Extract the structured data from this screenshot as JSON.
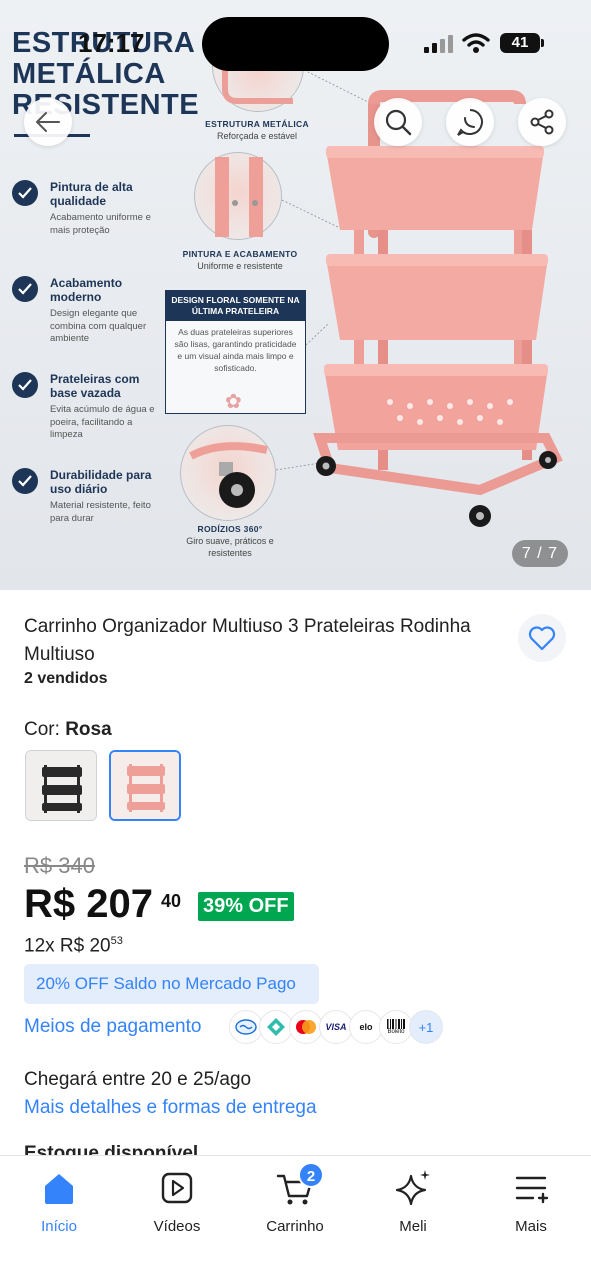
{
  "status_bar": {
    "time": "17:17",
    "battery": "41"
  },
  "gallery": {
    "promo_title_lines": [
      "ESTRUTURA",
      "METÁLICA",
      "RESISTENTE"
    ],
    "features": [
      {
        "title": "Pintura de alta qualidade",
        "desc": "Acabamento uniforme e mais proteção"
      },
      {
        "title": "Acabamento moderno",
        "desc": "Design elegante que combina com qualquer ambiente"
      },
      {
        "title": "Prateleiras com base vazada",
        "desc": "Evita acúmulo de água e poeira, facilitando a limpeza"
      },
      {
        "title": "Durabilidade para uso diário",
        "desc": "Material resistente, feito para durar"
      }
    ],
    "detail_structure": {
      "title": "ESTRUTURA METÁLICA",
      "desc": "Reforçada e estável"
    },
    "detail_paint": {
      "title": "PINTURA E ACABAMENTO",
      "desc": "Uniforme e resistente"
    },
    "floral_box": {
      "title": "DESIGN FLORAL SOMENTE NA ÚLTIMA PRATELEIRA",
      "text": "As duas prateleiras superiores são lisas, garantindo praticidade e um visual ainda mais limpo e sofisticado."
    },
    "detail_wheels": {
      "title": "RODÍZIOS 360°",
      "desc": "Giro suave, práticos e resistentes"
    },
    "counter": "7 / 7"
  },
  "product": {
    "title": "Carrinho Organizador Multiuso 3 Prateleiras Rodinha Multiuso",
    "sold": "2 vendidos",
    "color_label": "Cor: ",
    "color_value": "Rosa",
    "old_price": "R$ 340",
    "price": "R$ 207",
    "price_cents": "40",
    "discount": "39% OFF",
    "installments_prefix": "12x R$ 20",
    "installments_cents": "53",
    "saldo_badge": "20% OFF Saldo no Mercado Pago",
    "payment_link": "Meios de pagamento",
    "payment_icons": [
      "mercado-pago-icon",
      "pix-icon",
      "mastercard-icon",
      "VISA",
      "elo",
      "Boleto"
    ],
    "payment_more": "+1",
    "delivery": "Chegará entre 20 e 25/ago",
    "delivery_link": "Mais detalhes e formas de entrega",
    "stock": "Estoque disponível"
  },
  "bottom_nav": {
    "items": [
      {
        "label": "Início",
        "active": true
      },
      {
        "label": "Vídeos"
      },
      {
        "label": "Carrinho",
        "badge": "2"
      },
      {
        "label": "Meli"
      },
      {
        "label": "Mais"
      }
    ]
  },
  "colors": {
    "accent": "#3483fa",
    "discount_green": "#00a650",
    "navy": "#1d3557",
    "cart_pink": "#f0a7a0"
  }
}
